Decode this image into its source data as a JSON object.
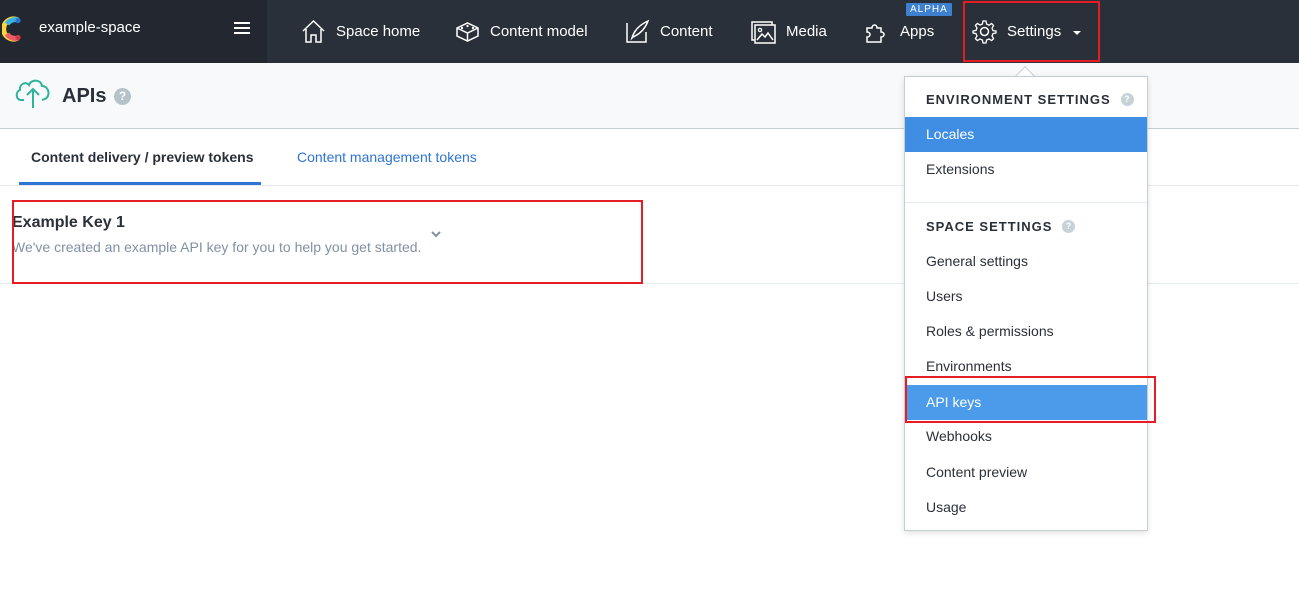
{
  "topbar": {
    "space_name": "example-space",
    "nav": [
      {
        "label": "Space home",
        "icon": "home-icon"
      },
      {
        "label": "Content model",
        "icon": "content-model-icon"
      },
      {
        "label": "Content",
        "icon": "content-icon"
      },
      {
        "label": "Media",
        "icon": "media-icon"
      },
      {
        "label": "Apps",
        "icon": "apps-icon",
        "badge": "ALPHA"
      },
      {
        "label": "Settings",
        "icon": "gear-icon"
      }
    ]
  },
  "header": {
    "title": "APIs",
    "help": "?"
  },
  "tabs": [
    {
      "label": "Content delivery / preview tokens",
      "active": true
    },
    {
      "label": "Content management tokens",
      "active": false
    }
  ],
  "api_key": {
    "name": "Example Key 1",
    "description": "We've created an example API key for you to help you get started."
  },
  "dropdown": {
    "environment_header": "ENVIRONMENT SETTINGS",
    "environment_items": [
      "Locales",
      "Extensions"
    ],
    "space_header": "SPACE SETTINGS",
    "space_items": [
      "General settings",
      "Users",
      "Roles & permissions",
      "Environments",
      "API keys",
      "Webhooks",
      "Content preview",
      "Usage"
    ],
    "help": "?"
  },
  "colors": {
    "topbar": "#2a3039",
    "accent_blue": "#2e75d4",
    "highlight_red": "#e51c23",
    "selected_item": "#3f8ee3",
    "api_icon_green": "#2db49b"
  }
}
